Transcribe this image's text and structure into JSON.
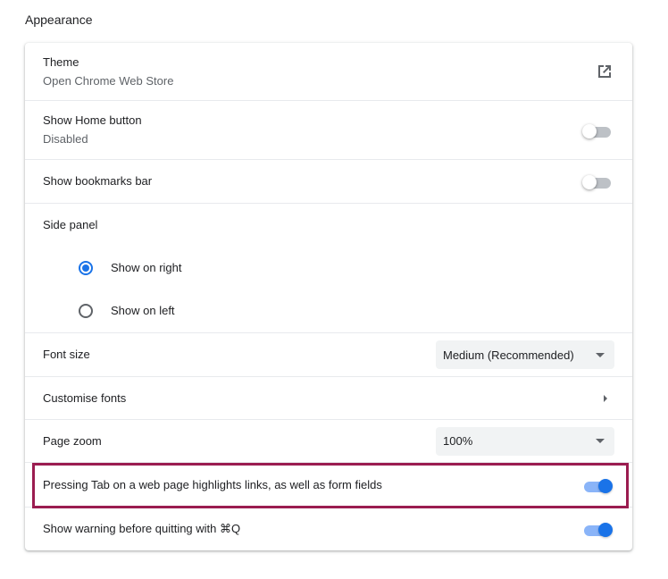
{
  "section": {
    "title": "Appearance"
  },
  "theme": {
    "label": "Theme",
    "sublabel": "Open Chrome Web Store",
    "icon": "external-link-icon"
  },
  "home_button": {
    "label": "Show Home button",
    "sublabel": "Disabled",
    "enabled": false
  },
  "bookmarks_bar": {
    "label": "Show bookmarks bar",
    "enabled": false
  },
  "side_panel": {
    "label": "Side panel",
    "options": [
      {
        "label": "Show on right",
        "checked": true
      },
      {
        "label": "Show on left",
        "checked": false
      }
    ]
  },
  "font_size": {
    "label": "Font size",
    "value": "Medium (Recommended)"
  },
  "customise_fonts": {
    "label": "Customise fonts"
  },
  "page_zoom": {
    "label": "Page zoom",
    "value": "100%"
  },
  "tab_highlight": {
    "label": "Pressing Tab on a web page highlights links, as well as form fields",
    "enabled": true
  },
  "quit_warning": {
    "label": "Show warning before quitting with ⌘Q",
    "enabled": true
  },
  "colors": {
    "accent": "#1a73e8",
    "highlight_border": "#9b1c50"
  }
}
